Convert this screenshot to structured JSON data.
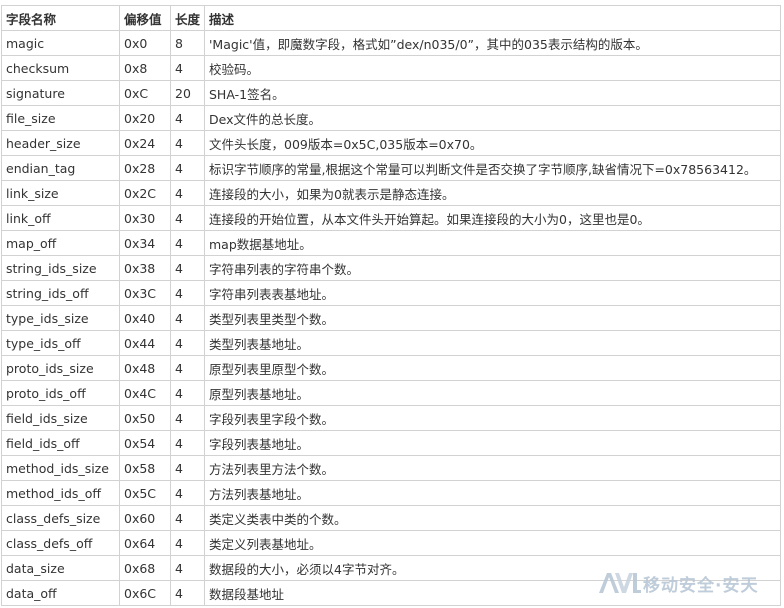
{
  "table": {
    "headers": [
      "字段名称",
      "偏移值",
      "长度",
      "描述"
    ],
    "rows": [
      [
        "magic",
        "0x0",
        "8",
        "'Magic'值，即魔数字段，格式如”dex/n035/0”，其中的035表示结构的版本。"
      ],
      [
        "checksum",
        "0x8",
        "4",
        "校验码。"
      ],
      [
        "signature",
        "0xC",
        "20",
        "SHA-1签名。"
      ],
      [
        "file_size",
        "0x20",
        "4",
        "Dex文件的总长度。"
      ],
      [
        "header_size",
        "0x24",
        "4",
        "文件头长度，009版本=0x5C,035版本=0x70。"
      ],
      [
        "endian_tag",
        "0x28",
        "4",
        "标识字节顺序的常量,根据这个常量可以判断文件是否交换了字节顺序,缺省情况下=0x78563412。"
      ],
      [
        "link_size",
        "0x2C",
        "4",
        "连接段的大小，如果为0就表示是静态连接。"
      ],
      [
        "link_off",
        "0x30",
        "4",
        "连接段的开始位置，从本文件头开始算起。如果连接段的大小为0，这里也是0。"
      ],
      [
        "map_off",
        "0x34",
        "4",
        "map数据基地址。"
      ],
      [
        "string_ids_size",
        "0x38",
        "4",
        "字符串列表的字符串个数。"
      ],
      [
        "string_ids_off",
        "0x3C",
        "4",
        "字符串列表表基地址。"
      ],
      [
        "type_ids_size",
        "0x40",
        "4",
        "类型列表里类型个数。"
      ],
      [
        "type_ids_off",
        "0x44",
        "4",
        "类型列表基地址。"
      ],
      [
        "proto_ids_size",
        "0x48",
        "4",
        "原型列表里原型个数。"
      ],
      [
        "proto_ids_off",
        "0x4C",
        "4",
        "原型列表基地址。"
      ],
      [
        "field_ids_size",
        "0x50",
        "4",
        "字段列表里字段个数。"
      ],
      [
        "field_ids_off",
        "0x54",
        "4",
        "字段列表基地址。"
      ],
      [
        "method_ids_size",
        "0x58",
        "4",
        "方法列表里方法个数。"
      ],
      [
        "method_ids_off",
        "0x5C",
        "4",
        "方法列表基地址。"
      ],
      [
        "class_defs_size",
        "0x60",
        "4",
        "类定义类表中类的个数。"
      ],
      [
        "class_defs_off",
        "0x64",
        "4",
        "类定义列表基地址。"
      ],
      [
        "data_size",
        "0x68",
        "4",
        "数据段的大小，必须以4字节对齐。"
      ],
      [
        "data_off",
        "0x6C",
        "4",
        "数据段基地址"
      ]
    ]
  },
  "watermark": {
    "logo_text": "AVL",
    "text": "移动安全·安天",
    "color": "#b9c7d6"
  },
  "colors": {
    "border": "#d2d2d2",
    "text": "#333333"
  }
}
